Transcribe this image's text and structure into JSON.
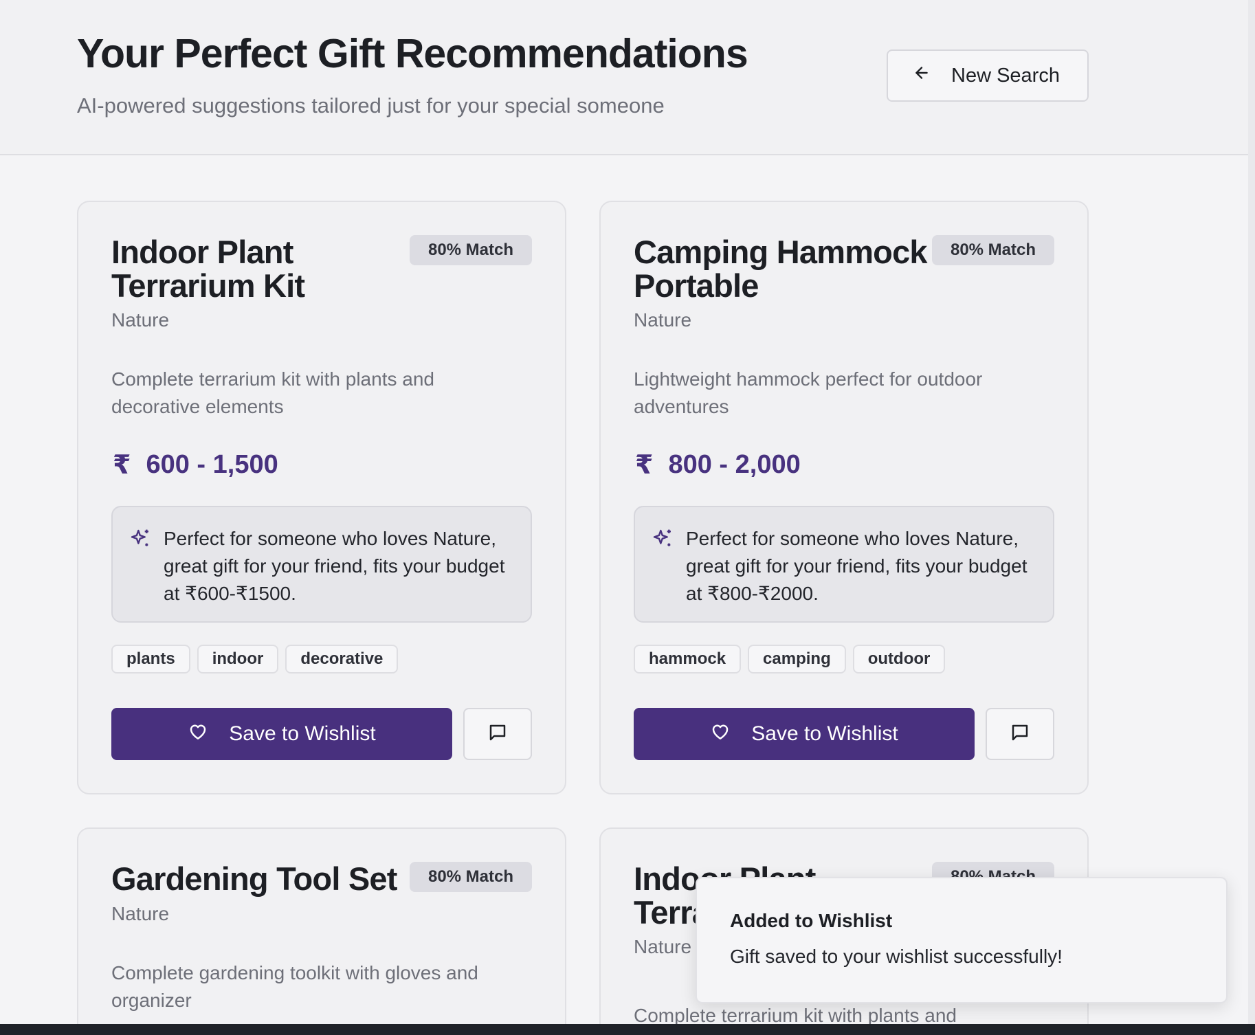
{
  "header": {
    "title": "Your Perfect Gift Recommendations",
    "subtitle": "AI-powered suggestions tailored just for your special someone",
    "new_search_label": "New Search"
  },
  "currency_symbol": "₹",
  "cards": [
    {
      "title": "Indoor Plant Terrarium Kit",
      "match": "80% Match",
      "category": "Nature",
      "description": "Complete terrarium kit with plants and decorative elements",
      "price": "600 - 1,500",
      "reason": "Perfect for someone who loves Nature, great gift for your friend, fits your budget at ₹600-₹1500.",
      "tags": [
        "plants",
        "indoor",
        "decorative"
      ],
      "wishlist_label": "Save to Wishlist"
    },
    {
      "title": "Camping Hammock Portable",
      "match": "80% Match",
      "category": "Nature",
      "description": "Lightweight hammock perfect for outdoor adventures",
      "price": "800 - 2,000",
      "reason": "Perfect for someone who loves Nature, great gift for your friend, fits your budget at ₹800-₹2000.",
      "tags": [
        "hammock",
        "camping",
        "outdoor"
      ],
      "wishlist_label": "Save to Wishlist"
    },
    {
      "title": "Gardening Tool Set",
      "match": "80% Match",
      "category": "Nature",
      "description": "Complete gardening toolkit with gloves and organizer"
    },
    {
      "title": "Indoor Plant Terrarium Kit",
      "match": "80% Match",
      "category": "Nature",
      "description": "Complete terrarium kit with plants and"
    }
  ],
  "toast": {
    "title": "Added to Wishlist",
    "message": "Gift saved to your wishlist successfully!"
  },
  "colors": {
    "primary": "#48307e",
    "price": "#48327f",
    "muted_text": "#6d6f78"
  },
  "icons": {
    "back": "arrow-left-icon",
    "currency": "rupee-icon",
    "reason": "sparkles-icon",
    "wishlist": "heart-icon",
    "comment": "message-square-icon"
  }
}
